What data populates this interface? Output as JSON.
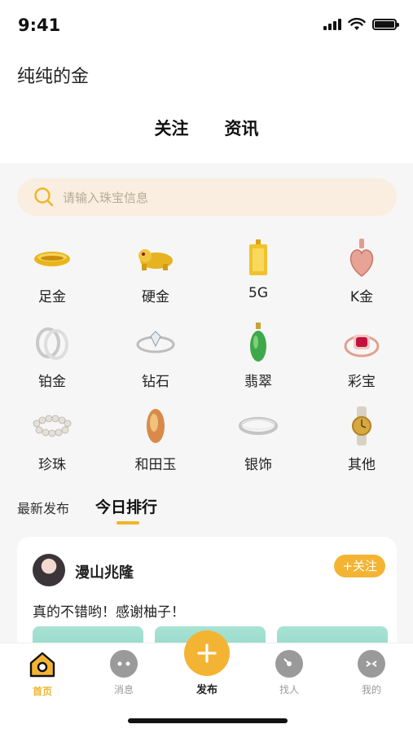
{
  "status_bar": {
    "time": "9:41"
  },
  "header": {
    "title": "纯纯的金",
    "tabs": [
      "关注",
      "资讯"
    ]
  },
  "search": {
    "placeholder": "请输入珠宝信息"
  },
  "categories": [
    {
      "label": "足金",
      "icon": "gold-ring-icon"
    },
    {
      "label": "硬金",
      "icon": "gold-pixiu-icon"
    },
    {
      "label": "5G",
      "icon": "gold-bar-icon"
    },
    {
      "label": "K金",
      "icon": "rose-gold-pendant-icon"
    },
    {
      "label": "铂金",
      "icon": "platinum-rings-icon"
    },
    {
      "label": "钻石",
      "icon": "diamond-ring-icon"
    },
    {
      "label": "翡翠",
      "icon": "jade-pendant-icon"
    },
    {
      "label": "彩宝",
      "icon": "ruby-ring-icon"
    },
    {
      "label": "珍珠",
      "icon": "pearl-necklace-icon"
    },
    {
      "label": "和田玉",
      "icon": "hetian-jade-icon"
    },
    {
      "label": "银饰",
      "icon": "silver-bangle-icon"
    },
    {
      "label": "其他",
      "icon": "watch-icon"
    }
  ],
  "feed_tabs": [
    "最新发布",
    "今日排行"
  ],
  "post": {
    "author": "漫山兆隆",
    "follow_label": "+关注",
    "text": "真的不错哟！感谢柚子！"
  },
  "tabbar": {
    "items": [
      "首页",
      "消息",
      "发布",
      "找人",
      "我的"
    ]
  },
  "colors": {
    "accent": "#f4b433",
    "search_bg": "#f9eee0"
  }
}
